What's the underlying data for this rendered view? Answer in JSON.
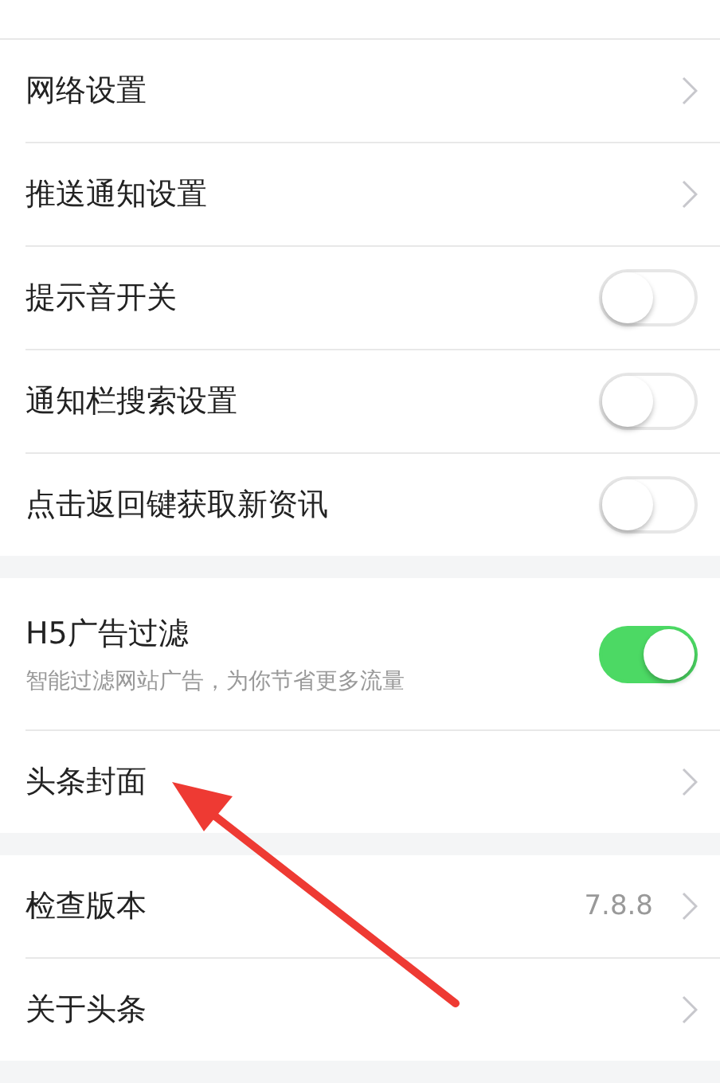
{
  "sections": [
    {
      "rows": [
        {
          "kind": "link",
          "label": "网络设置"
        },
        {
          "kind": "link",
          "label": "推送通知设置"
        },
        {
          "kind": "toggle",
          "label": "提示音开关",
          "on": false
        },
        {
          "kind": "toggle",
          "label": "通知栏搜索设置",
          "on": false
        },
        {
          "kind": "toggle",
          "label": "点击返回键获取新资讯",
          "on": false
        }
      ]
    },
    {
      "rows": [
        {
          "kind": "toggle",
          "label": "H5广告过滤",
          "subtitle": "智能过滤网站广告，为你节省更多流量",
          "on": true
        },
        {
          "kind": "link",
          "label": "头条封面"
        }
      ]
    },
    {
      "rows": [
        {
          "kind": "link",
          "label": "检查版本",
          "value": "7.8.8"
        },
        {
          "kind": "link",
          "label": "关于头条"
        }
      ]
    }
  ]
}
